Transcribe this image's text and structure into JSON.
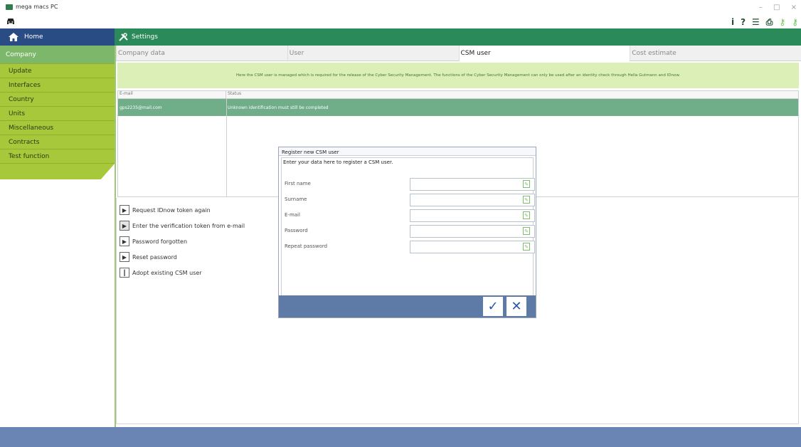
{
  "window": {
    "title": "mega macs PC",
    "controls": [
      "–",
      "□",
      "×"
    ]
  },
  "toolbar": {
    "icons": [
      "info-icon",
      "help-icon",
      "list-icon",
      "printer-icon",
      "key-icon",
      "tools-icon"
    ],
    "info": "i",
    "help": "?",
    "list": "☰",
    "print": "⎙",
    "key": "⚷",
    "tools": "⚷"
  },
  "nav": {
    "home_label": "Home",
    "settings_label": "Settings"
  },
  "sidebar": {
    "items": [
      {
        "label": "Company",
        "active": true
      },
      {
        "label": "Update",
        "active": false
      },
      {
        "label": "Interfaces",
        "active": false
      },
      {
        "label": "Country",
        "active": false
      },
      {
        "label": "Units",
        "active": false
      },
      {
        "label": "Miscellaneous",
        "active": false
      },
      {
        "label": "Contracts",
        "active": false
      },
      {
        "label": "Test function",
        "active": false
      }
    ]
  },
  "tabs": [
    {
      "label": "Company data",
      "active": false
    },
    {
      "label": "User",
      "active": false
    },
    {
      "label": "CSM user",
      "active": true
    },
    {
      "label": "Cost estimate",
      "active": false
    }
  ],
  "info_text": "Here the CSM user is managed which is required for the release of the Cyber Security Management. The functions of the Cyber Security Management can only be used after an identity check through Hella Gutmann and IDnow.",
  "table": {
    "headers": {
      "email": "E-mail",
      "status": "Status"
    },
    "rows": [
      {
        "email": "gps2235@mail.com",
        "status": "Unknown identification must still be completed"
      }
    ]
  },
  "actions": [
    {
      "label": "Request IDnow token again",
      "icon": "▶"
    },
    {
      "label": "Enter the verification token from e-mail",
      "icon": "▶"
    },
    {
      "label": "Password forgotten",
      "icon": "▶"
    },
    {
      "label": "Reset password",
      "icon": "▶"
    },
    {
      "label": "Adopt existing CSM user",
      "icon": "┃"
    }
  ],
  "dialog": {
    "title": "Register new CSM user",
    "intro": "Enter your data here to register a CSM user.",
    "fields": [
      {
        "label": "First name",
        "value": ""
      },
      {
        "label": "Surname",
        "value": ""
      },
      {
        "label": "E-mail",
        "value": ""
      },
      {
        "label": "Password",
        "value": ""
      },
      {
        "label": "Repeat password",
        "value": ""
      }
    ],
    "ok": "✓",
    "cancel": "✕"
  },
  "colors": {
    "nav_blue": "#2a4c85",
    "settings_green": "#2a8a5a",
    "sidebar_lime": "#a8c83c",
    "row_highlight": "#6fae89",
    "dialog_footer": "#5e7ba8",
    "bottom_bar": "#6a85b3"
  }
}
